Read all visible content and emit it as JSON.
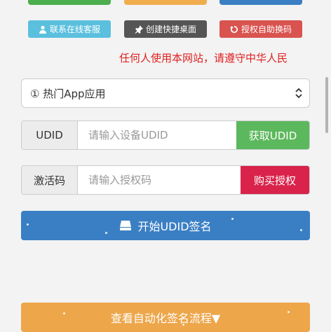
{
  "toolbar": {
    "contact_label": "联系在线客服",
    "shortcut_label": "创建快捷桌面",
    "exchange_label": "授权自助换码"
  },
  "notice": "任何人使用本网站，请遵守中华人民",
  "app_select": {
    "value": "① 热门App应用"
  },
  "udid": {
    "label": "UDID",
    "placeholder": "请输入设备UDID",
    "button": "获取UDID"
  },
  "activation": {
    "label": "激活码",
    "placeholder": "请输入授权码",
    "button": "购买授权"
  },
  "start_button": "开始UDID签名",
  "flow_button": "查看自动化签名流程▼",
  "colors": {
    "green": "#5cb85c",
    "info": "#5bc0de",
    "dark": "#555555",
    "danger": "#d9534f",
    "crimson": "#d9234b",
    "primary": "#3a7fc4",
    "warning": "#eda64a",
    "notice_red": "#e02020"
  }
}
